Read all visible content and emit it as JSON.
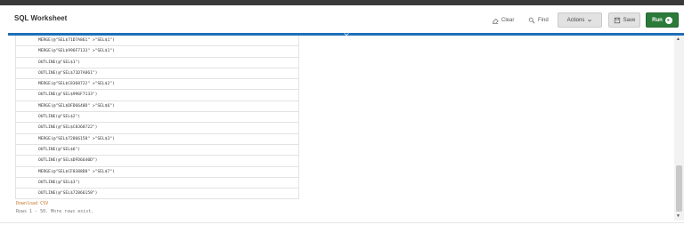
{
  "header": {
    "title": "SQL Worksheet",
    "clear_label": "Clear",
    "find_label": "Find",
    "actions_label": "Actions",
    "save_label": "Save",
    "run_label": "Run"
  },
  "results": {
    "rows": [
      "MERGE(@\"SEL$71D7A861\" >\"SEL$1\")",
      "MERGE(@\"SEL$996F7133\" >\"SEL$1\")",
      "OUTLINE(@\"SEL$1\")",
      "OUTLINE(@\"SEL$71D7A861\")",
      "MERGE(@\"SEL$C8368722\" >\"SEL$2\")",
      "OUTLINE(@\"SEL$996F7133\")",
      "MERGE(@\"SEL$DFD6640D\" >\"SEL$6\")",
      "OUTLINE(@\"SEL$2\")",
      "OUTLINE(@\"SEL$C8368722\")",
      "MERGE(@\"SEL$72866158\" >\"SEL$3\")",
      "OUTLINE(@\"SEL$6\")",
      "OUTLINE(@\"SEL$DFD6640D\")",
      "MERGE(@\"SEL$CF8388D8\" >\"SEL$7\")",
      "OUTLINE(@\"SEL$3\")",
      "OUTLINE(@\"SEL$72866158\")"
    ],
    "download_label": "Download CSV",
    "rows_info": "Rows 1 - 50. More rows exist."
  },
  "colors": {
    "accent_blue": "#1f6fb8",
    "run_green": "#2c7a3a",
    "download_orange": "#c8742a"
  },
  "icons": {
    "clear": "eraser-icon",
    "find": "find-icon",
    "actions": "chevron-down-icon",
    "save": "save-icon",
    "run": "play-icon"
  }
}
